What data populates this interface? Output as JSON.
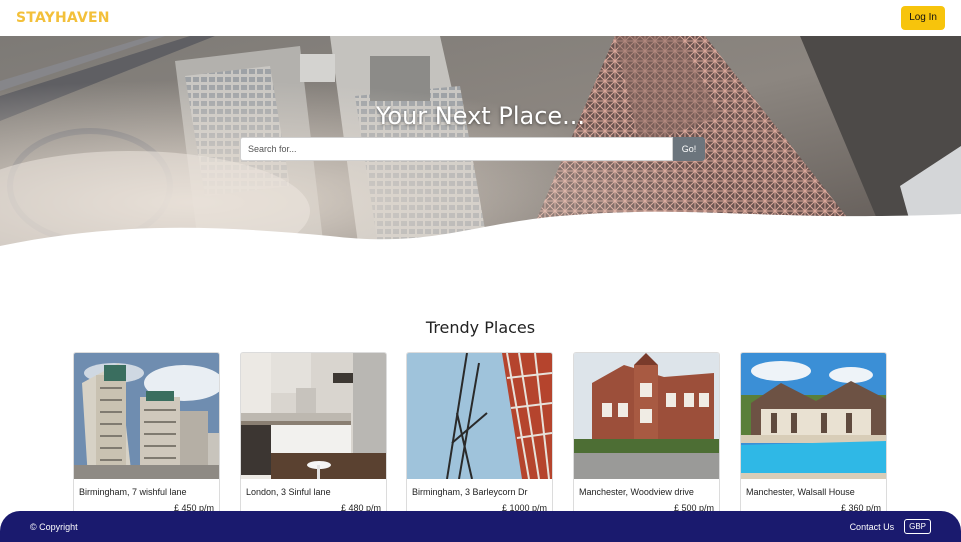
{
  "header": {
    "brand": "STAYHAVEN",
    "login_label": "Log In"
  },
  "hero": {
    "title": "Your Next Place...",
    "search_placeholder": "Search for...",
    "search_button": "Go!"
  },
  "trendy": {
    "title": "Trendy Places",
    "items": [
      {
        "title": "Birmingham, 7 wishful lane",
        "price": "£ 450 p/m",
        "image": "tower-blocks-photo"
      },
      {
        "title": "London, 3 Sinful lane",
        "price": "£ 480 p/m",
        "image": "kitchen-interior-photo"
      },
      {
        "title": "Birmingham, 3 Barleycorn Dr",
        "price": "£ 1000 p/m",
        "image": "building-frame-photo"
      },
      {
        "title": "Manchester, Woodview drive",
        "price": "£ 500 p/m",
        "image": "brick-house-photo"
      },
      {
        "title": "Manchester, Walsall House",
        "price": "£ 360 p/m",
        "image": "villa-pool-photo"
      }
    ]
  },
  "footer": {
    "copyright": "© Copyright",
    "contact": "Contact Us",
    "currency": "GBP"
  },
  "colors": {
    "brand": "#f3c03a",
    "login_button": "#f7c40c",
    "footer_bg": "#1a1a6e",
    "search_button": "#6c757d"
  }
}
